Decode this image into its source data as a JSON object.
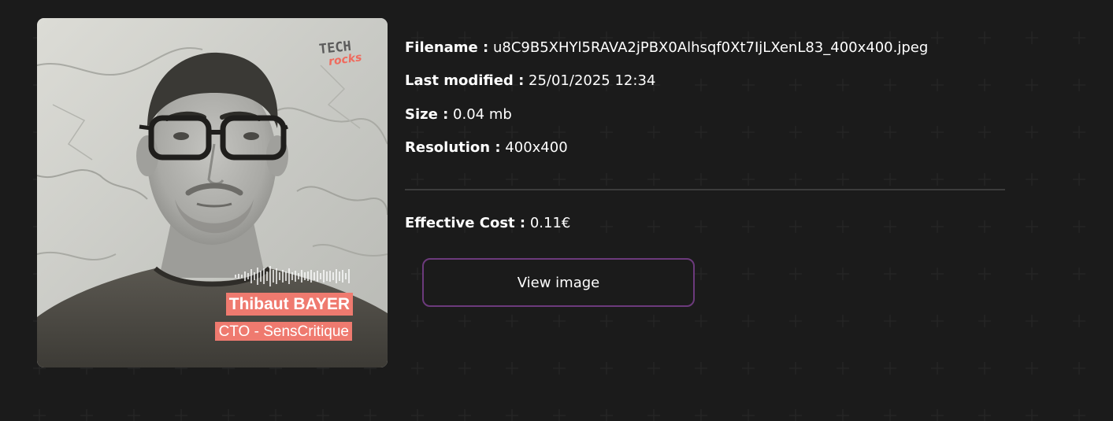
{
  "photo": {
    "person_name": "Thibaut BAYER",
    "person_role": "CTO - SensCritique",
    "logo_line1": "TECH",
    "logo_line2": "rocks"
  },
  "details": {
    "filename_label": "Filename :",
    "filename_value": "u8C9B5XHYl5RAVA2jPBX0Alhsqf0Xt7IjLXenL83_400x400.jpeg",
    "modified_label": "Last modified :",
    "modified_value": "25/01/2025 12:34",
    "size_label": "Size :",
    "size_value": "0.04 mb",
    "resolution_label": "Resolution :",
    "resolution_value": "400x400",
    "cost_label": "Effective Cost :",
    "cost_value": "0.11€"
  },
  "actions": {
    "view_image_label": "View image"
  },
  "colors": {
    "background": "#1b1b1b",
    "divider": "#3c3c3c",
    "button_border": "#6c3a7c",
    "tag_background": "#ef7a6f"
  }
}
